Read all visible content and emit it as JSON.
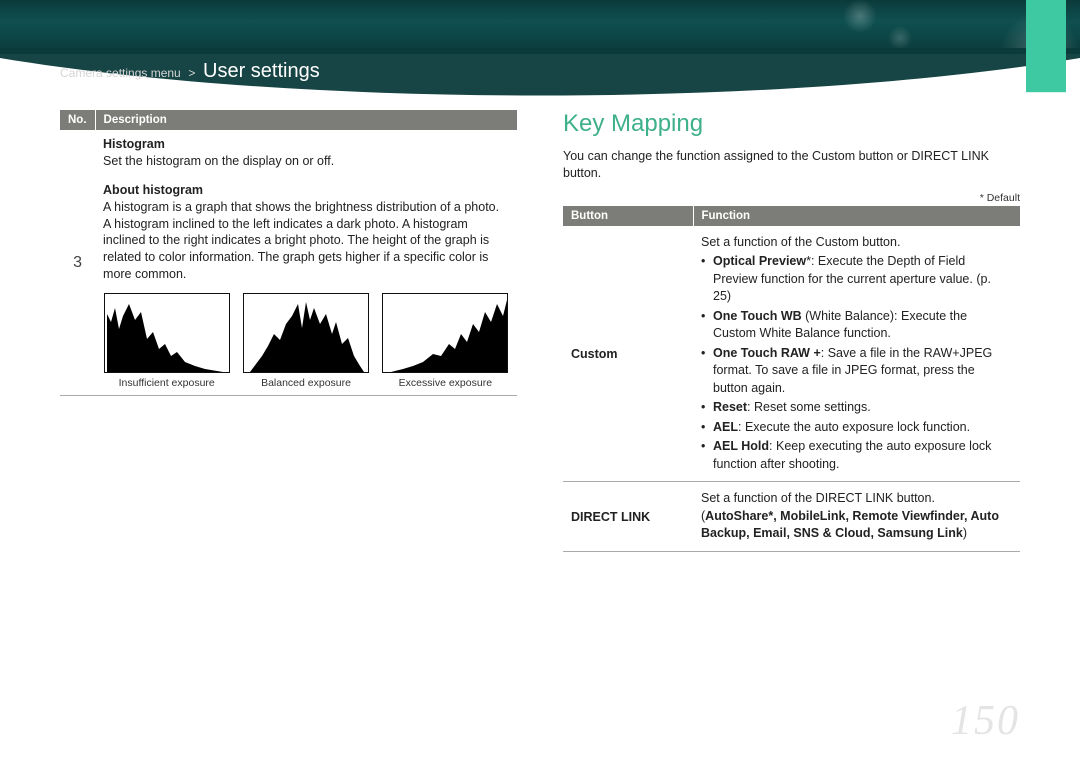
{
  "breadcrumb": {
    "parent": "Camera settings menu",
    "sep": ">",
    "current": "User settings"
  },
  "left": {
    "headers": {
      "no": "No.",
      "desc": "Description"
    },
    "row_no": "3",
    "histogram": {
      "title": "Histogram",
      "line": "Set the histogram on the display on or off.",
      "about_title": "About histogram",
      "about_body": "A histogram is a graph that shows the brightness distribution of a photo. A histogram inclined to the left indicates a dark photo. A histogram inclined to the right indicates a bright photo. The height of the graph is related to color information. The graph gets higher if a specific color is more common."
    },
    "histo_captions": {
      "insufficient": "Insufficient exposure",
      "balanced": "Balanced exposure",
      "excessive": "Excessive exposure"
    }
  },
  "right": {
    "heading": "Key Mapping",
    "intro": "You can change the function assigned to the Custom button or DIRECT LINK button.",
    "default_note": "* Default",
    "headers": {
      "button": "Button",
      "function": "Function"
    },
    "custom": {
      "label": "Custom",
      "lead": "Set a function of the Custom button.",
      "items": {
        "optical_label": "Optical Preview",
        "optical_rest": "*: Execute the Depth of Field Preview function for the current aperture value. (p. 25)",
        "otwb_label": "One Touch WB",
        "otwb_paren": " (White Balance): ",
        "otwb_rest": "Execute the Custom White Balance function.",
        "raw_label": "One Touch RAW +",
        "raw_rest": ": Save a file in the RAW+JPEG format. To save a file in JPEG format, press the button again.",
        "reset_label": "Reset",
        "reset_rest": ": Reset some settings.",
        "ael_label": "AEL",
        "ael_rest": ": Execute the auto exposure lock function.",
        "aelh_label": "AEL Hold",
        "aelh_rest": ": Keep executing the auto exposure lock function after shooting."
      }
    },
    "direct": {
      "label": "DIRECT LINK",
      "lead": "Set a function of the DIRECT LINK button.",
      "options_line1": "AutoShare*, MobileLink, Remote Viewfinder, Auto",
      "options_line2": "Backup, Email, SNS & Cloud, Samsung Link"
    }
  },
  "page_number": "150"
}
